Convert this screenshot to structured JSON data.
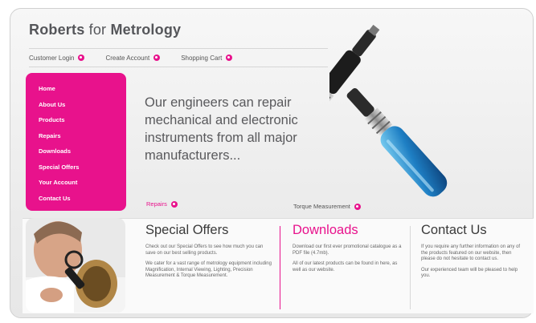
{
  "brand": {
    "name_a": "Roberts",
    "name_b": "for",
    "name_c": "Metrology"
  },
  "topnav": [
    {
      "label": "Customer Login"
    },
    {
      "label": "Create Account"
    },
    {
      "label": "Shopping Cart"
    }
  ],
  "sidenav": [
    {
      "label": "Home"
    },
    {
      "label": "About Us"
    },
    {
      "label": "Products"
    },
    {
      "label": "Repairs"
    },
    {
      "label": "Downloads"
    },
    {
      "label": "Special Offers"
    },
    {
      "label": "Your Account"
    },
    {
      "label": "Contact Us"
    }
  ],
  "hero": {
    "text": "Our engineers can repair mechanical and electronic instruments from all major manufacturers..."
  },
  "links": {
    "repairs": "Repairs",
    "torque": "Torque Measurement"
  },
  "sections": {
    "special": {
      "title": "Special Offers",
      "p1": "Check out our Special Offers to see how much you can save on our best selling products.",
      "p2": "We cater for a vast range of metrology equipment including Magnification, Internal Viewing, Lighting, Precision Measurement & Torque Measurement."
    },
    "downloads": {
      "title": "Downloads",
      "p1": "Download our first ever promotional catalogue as a PDF file (4.7mb).",
      "p2": "All of our latest products can be found in here, as well as our website."
    },
    "contact": {
      "title": "Contact Us",
      "p1": "If you require any further information on any of the products featured on our website, then please do not hesitate to contact us.",
      "p2": "Our experienced team will be pleased to help you."
    }
  },
  "colors": {
    "accent": "#e8128c",
    "text": "#59595c"
  }
}
